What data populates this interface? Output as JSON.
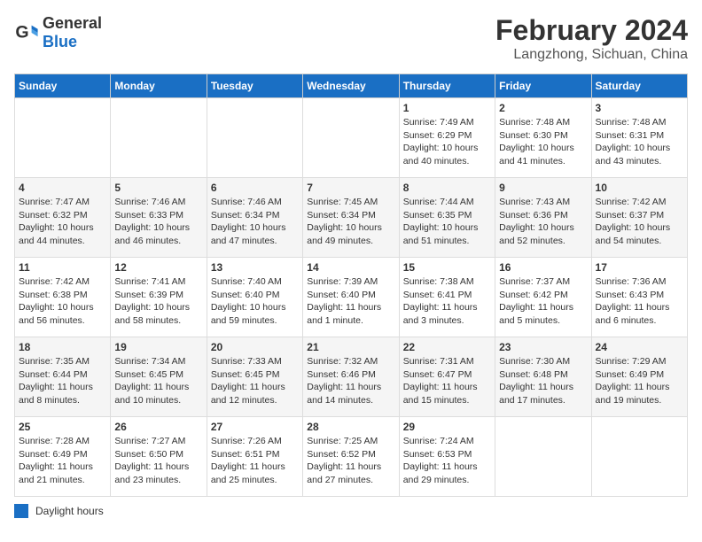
{
  "header": {
    "logo_general": "General",
    "logo_blue": "Blue",
    "main_title": "February 2024",
    "sub_title": "Langzhong, Sichuan, China"
  },
  "weekdays": [
    "Sunday",
    "Monday",
    "Tuesday",
    "Wednesday",
    "Thursday",
    "Friday",
    "Saturday"
  ],
  "weeks": [
    [
      {
        "day": "",
        "info": ""
      },
      {
        "day": "",
        "info": ""
      },
      {
        "day": "",
        "info": ""
      },
      {
        "day": "",
        "info": ""
      },
      {
        "day": "1",
        "info": "Sunrise: 7:49 AM\nSunset: 6:29 PM\nDaylight: 10 hours and 40 minutes."
      },
      {
        "day": "2",
        "info": "Sunrise: 7:48 AM\nSunset: 6:30 PM\nDaylight: 10 hours and 41 minutes."
      },
      {
        "day": "3",
        "info": "Sunrise: 7:48 AM\nSunset: 6:31 PM\nDaylight: 10 hours and 43 minutes."
      }
    ],
    [
      {
        "day": "4",
        "info": "Sunrise: 7:47 AM\nSunset: 6:32 PM\nDaylight: 10 hours and 44 minutes."
      },
      {
        "day": "5",
        "info": "Sunrise: 7:46 AM\nSunset: 6:33 PM\nDaylight: 10 hours and 46 minutes."
      },
      {
        "day": "6",
        "info": "Sunrise: 7:46 AM\nSunset: 6:34 PM\nDaylight: 10 hours and 47 minutes."
      },
      {
        "day": "7",
        "info": "Sunrise: 7:45 AM\nSunset: 6:34 PM\nDaylight: 10 hours and 49 minutes."
      },
      {
        "day": "8",
        "info": "Sunrise: 7:44 AM\nSunset: 6:35 PM\nDaylight: 10 hours and 51 minutes."
      },
      {
        "day": "9",
        "info": "Sunrise: 7:43 AM\nSunset: 6:36 PM\nDaylight: 10 hours and 52 minutes."
      },
      {
        "day": "10",
        "info": "Sunrise: 7:42 AM\nSunset: 6:37 PM\nDaylight: 10 hours and 54 minutes."
      }
    ],
    [
      {
        "day": "11",
        "info": "Sunrise: 7:42 AM\nSunset: 6:38 PM\nDaylight: 10 hours and 56 minutes."
      },
      {
        "day": "12",
        "info": "Sunrise: 7:41 AM\nSunset: 6:39 PM\nDaylight: 10 hours and 58 minutes."
      },
      {
        "day": "13",
        "info": "Sunrise: 7:40 AM\nSunset: 6:40 PM\nDaylight: 10 hours and 59 minutes."
      },
      {
        "day": "14",
        "info": "Sunrise: 7:39 AM\nSunset: 6:40 PM\nDaylight: 11 hours and 1 minute."
      },
      {
        "day": "15",
        "info": "Sunrise: 7:38 AM\nSunset: 6:41 PM\nDaylight: 11 hours and 3 minutes."
      },
      {
        "day": "16",
        "info": "Sunrise: 7:37 AM\nSunset: 6:42 PM\nDaylight: 11 hours and 5 minutes."
      },
      {
        "day": "17",
        "info": "Sunrise: 7:36 AM\nSunset: 6:43 PM\nDaylight: 11 hours and 6 minutes."
      }
    ],
    [
      {
        "day": "18",
        "info": "Sunrise: 7:35 AM\nSunset: 6:44 PM\nDaylight: 11 hours and 8 minutes."
      },
      {
        "day": "19",
        "info": "Sunrise: 7:34 AM\nSunset: 6:45 PM\nDaylight: 11 hours and 10 minutes."
      },
      {
        "day": "20",
        "info": "Sunrise: 7:33 AM\nSunset: 6:45 PM\nDaylight: 11 hours and 12 minutes."
      },
      {
        "day": "21",
        "info": "Sunrise: 7:32 AM\nSunset: 6:46 PM\nDaylight: 11 hours and 14 minutes."
      },
      {
        "day": "22",
        "info": "Sunrise: 7:31 AM\nSunset: 6:47 PM\nDaylight: 11 hours and 15 minutes."
      },
      {
        "day": "23",
        "info": "Sunrise: 7:30 AM\nSunset: 6:48 PM\nDaylight: 11 hours and 17 minutes."
      },
      {
        "day": "24",
        "info": "Sunrise: 7:29 AM\nSunset: 6:49 PM\nDaylight: 11 hours and 19 minutes."
      }
    ],
    [
      {
        "day": "25",
        "info": "Sunrise: 7:28 AM\nSunset: 6:49 PM\nDaylight: 11 hours and 21 minutes."
      },
      {
        "day": "26",
        "info": "Sunrise: 7:27 AM\nSunset: 6:50 PM\nDaylight: 11 hours and 23 minutes."
      },
      {
        "day": "27",
        "info": "Sunrise: 7:26 AM\nSunset: 6:51 PM\nDaylight: 11 hours and 25 minutes."
      },
      {
        "day": "28",
        "info": "Sunrise: 7:25 AM\nSunset: 6:52 PM\nDaylight: 11 hours and 27 minutes."
      },
      {
        "day": "29",
        "info": "Sunrise: 7:24 AM\nSunset: 6:53 PM\nDaylight: 11 hours and 29 minutes."
      },
      {
        "day": "",
        "info": ""
      },
      {
        "day": "",
        "info": ""
      }
    ]
  ],
  "footer": {
    "daylight_label": "Daylight hours"
  }
}
